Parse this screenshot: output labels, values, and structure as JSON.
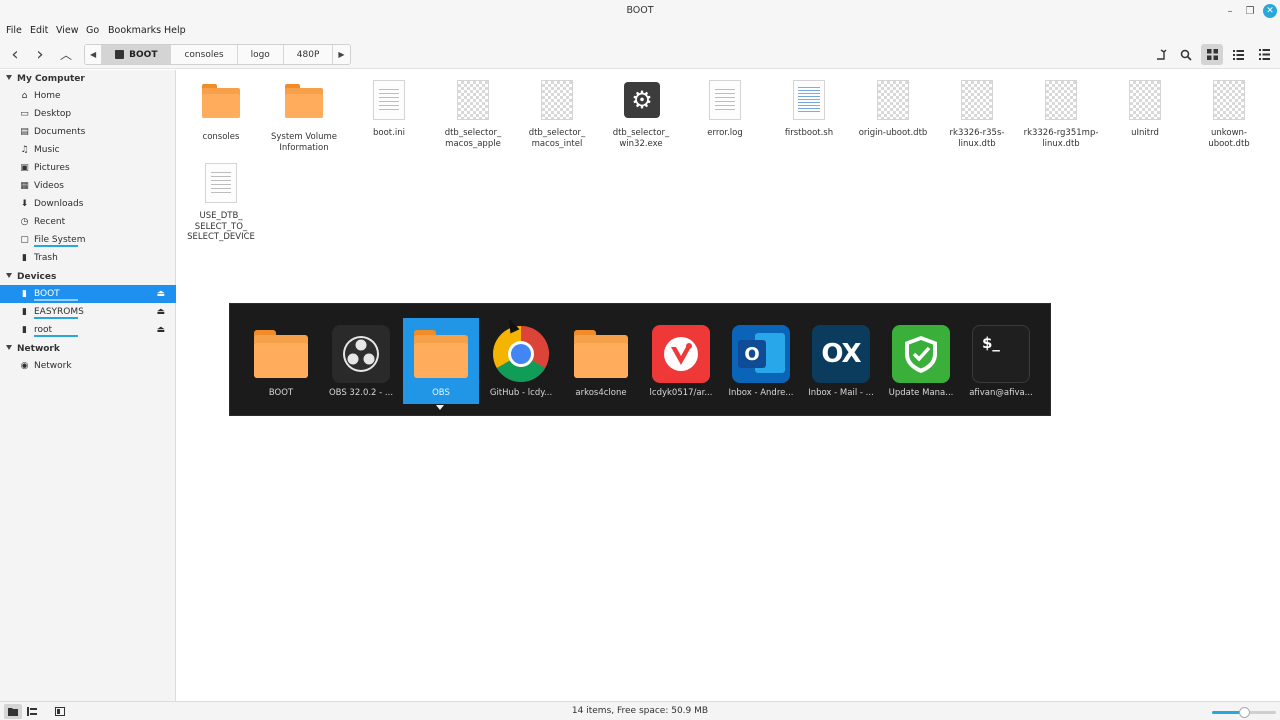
{
  "window": {
    "title": "BOOT",
    "minimize_glyph": "–",
    "maximize_glyph": "❐",
    "close_glyph": "✕"
  },
  "menu": [
    "File",
    "Edit",
    "View",
    "Go",
    "Bookmarks",
    "Help"
  ],
  "toolbar": {
    "back_icon": "‹",
    "forward_icon": "›",
    "up_icon": "︿",
    "crumb_left": "◀",
    "crumb_right": "▶",
    "breadcrumbs": [
      "BOOT",
      "consoles",
      "logo",
      "480P"
    ]
  },
  "sidebar": {
    "sections": {
      "my_computer": "My Computer",
      "devices": "Devices",
      "network": "Network"
    },
    "my_computer_items": [
      {
        "label": "Home",
        "icon": "⌂"
      },
      {
        "label": "Desktop",
        "icon": "▭"
      },
      {
        "label": "Documents",
        "icon": "▤"
      },
      {
        "label": "Music",
        "icon": "♫"
      },
      {
        "label": "Pictures",
        "icon": "▣"
      },
      {
        "label": "Videos",
        "icon": "▦"
      },
      {
        "label": "Downloads",
        "icon": "⬇"
      },
      {
        "label": "Recent",
        "icon": "◷"
      },
      {
        "label": "File System",
        "icon": "▢"
      },
      {
        "label": "Trash",
        "icon": "▮"
      }
    ],
    "device_items": [
      {
        "label": "BOOT",
        "eject": "⏏"
      },
      {
        "label": "EASYROMS",
        "eject": "⏏"
      },
      {
        "label": "root",
        "eject": "⏏"
      }
    ],
    "network_items": [
      {
        "label": "Network",
        "icon": "◉"
      }
    ]
  },
  "files": [
    {
      "name": "consoles",
      "kind": "folder"
    },
    {
      "name": "System Volume Information",
      "kind": "folder"
    },
    {
      "name": "boot.ini",
      "kind": "doc"
    },
    {
      "name": "dtb_selector_ macos_apple",
      "kind": "checker"
    },
    {
      "name": "dtb_selector_ macos_intel",
      "kind": "checker"
    },
    {
      "name": "dtb_selector_ win32.exe",
      "kind": "exe"
    },
    {
      "name": "error.log",
      "kind": "doc"
    },
    {
      "name": "firstboot.sh",
      "kind": "script"
    },
    {
      "name": "origin-uboot.dtb",
      "kind": "checker"
    },
    {
      "name": "rk3326-r35s-linux.dtb",
      "kind": "checker"
    },
    {
      "name": "rk3326-rg351mp-linux.dtb",
      "kind": "checker"
    },
    {
      "name": "uInitrd",
      "kind": "checker"
    },
    {
      "name": "unkown-uboot.dtb",
      "kind": "checker"
    },
    {
      "name": "USE_DTB_ SELECT_TO_ SELECT_DEVICE",
      "kind": "doc"
    }
  ],
  "switcher": {
    "items": [
      {
        "label": "BOOT",
        "kind": "folder",
        "active": false
      },
      {
        "label": "OBS 32.0.2 - ...",
        "kind": "obs",
        "active": false
      },
      {
        "label": "OBS",
        "kind": "folder",
        "active": true
      },
      {
        "label": "GitHub - lcdy...",
        "kind": "chrome",
        "active": false
      },
      {
        "label": "arkos4clone",
        "kind": "folder",
        "active": false
      },
      {
        "label": "lcdyk0517/ar...",
        "kind": "vivaldi",
        "active": false
      },
      {
        "label": "Inbox - Andre...",
        "kind": "outlook",
        "active": false
      },
      {
        "label": "Inbox - Mail - ...",
        "kind": "ox",
        "active": false
      },
      {
        "label": "Update Mana...",
        "kind": "shield",
        "active": false
      },
      {
        "label": "afivan@afiva...",
        "kind": "terminal",
        "active": false
      }
    ],
    "ox_text": "OX",
    "outlook_text": "O",
    "terminal_text": "$_"
  },
  "status": {
    "text": "14 items, Free space: 50.9 MB",
    "zoom_level": 0.5
  },
  "colors": {
    "accent": "#1e90f0",
    "folder": "#f6a04a"
  }
}
